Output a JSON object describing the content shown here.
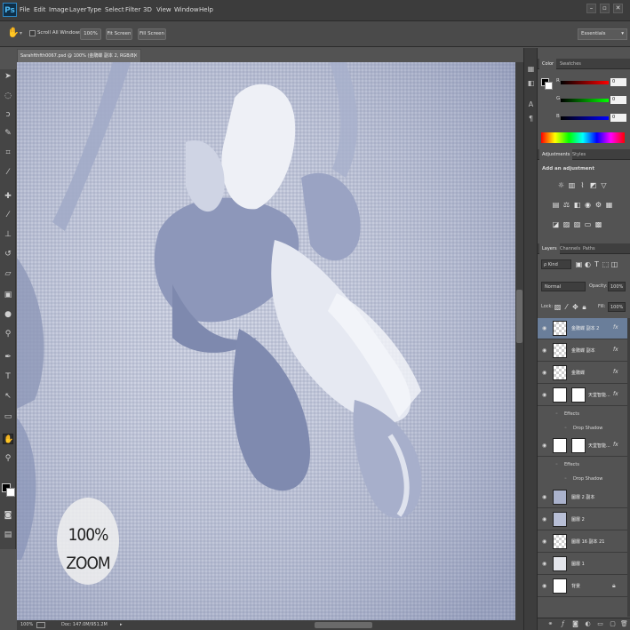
{
  "app": {
    "logo": "Ps",
    "menus": [
      "File",
      "Edit",
      "Image",
      "Layer",
      "Type",
      "Select",
      "Filter",
      "3D",
      "View",
      "Window",
      "Help"
    ],
    "window_controls": [
      "–",
      "▫",
      "✕"
    ]
  },
  "options_bar": {
    "scroll_all_windows": "Scroll All Windows",
    "btn_100": "100%",
    "btn_fit": "Fit Screen",
    "btn_fill": "Fill Screen",
    "workspace": "Essentials"
  },
  "document": {
    "tab_title": "Sarahfthfth0067.psd @ 100% (金鵰蝶 副本 2, RGB/8)",
    "zoom_badge_line1": "100%",
    "zoom_badge_line2": "ZOOM"
  },
  "status": {
    "zoom": "100%",
    "doc": "Doc: 147.0M/951.2M"
  },
  "color_panel": {
    "tabs": [
      "Color",
      "Swatches"
    ],
    "r": {
      "label": "R",
      "value": "0"
    },
    "g": {
      "label": "G",
      "value": "0"
    },
    "b": {
      "label": "B",
      "value": "0"
    }
  },
  "adjustments_panel": {
    "tabs": [
      "Adjustments",
      "Styles"
    ],
    "heading": "Add an adjustment"
  },
  "layers_panel": {
    "tabs": [
      "Layers",
      "Channels",
      "Paths"
    ],
    "filter": "ρ Kind",
    "blend": "Normal",
    "opacity_label": "Opacity:",
    "opacity": "100%",
    "lock_label": "Lock:",
    "fill_label": "Fill:",
    "fill": "100%",
    "layers": [
      {
        "name": "金鵰蝶 副本 2",
        "fx": "fx",
        "active": true
      },
      {
        "name": "金鵰蝶 副本",
        "fx": "fx",
        "active": false
      },
      {
        "name": "金鵰蝶",
        "fx": "fx",
        "active": false
      },
      {
        "name": "天堂智能...",
        "fx": "fx",
        "active": false
      },
      {
        "name": "天堂智能...",
        "fx": "fx",
        "active": false
      },
      {
        "name": "圖層 2 副本",
        "fx": "",
        "active": false
      },
      {
        "name": "圖層 2",
        "fx": "",
        "active": false
      },
      {
        "name": "圖層 16 副本 21",
        "fx": "",
        "active": false
      },
      {
        "name": "圖層 1",
        "fx": "",
        "active": false
      },
      {
        "name": "背景",
        "fx": "",
        "active": false
      }
    ],
    "effects_label": "Effects",
    "drop_shadow_label": "Drop Shadow"
  },
  "colors": {
    "accent_selection": "#6a7e9a",
    "canvas_base": "#b9bfd3"
  }
}
